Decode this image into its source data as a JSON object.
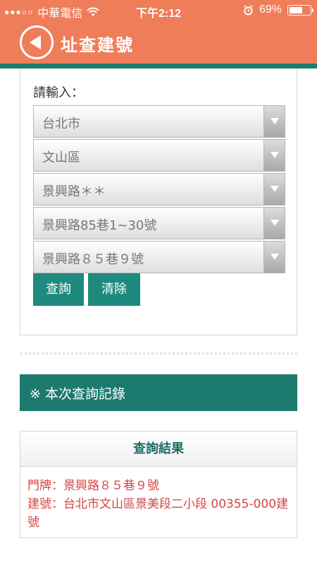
{
  "status_bar": {
    "carrier": "中華電信",
    "time": "下午2:12",
    "battery": "69%",
    "battery_level": 0.69
  },
  "header": {
    "title": "址查建號"
  },
  "form": {
    "prompt": "請輸入：",
    "selects": [
      {
        "value": "台北市"
      },
      {
        "value": "文山區"
      },
      {
        "value": "景興路＊＊"
      },
      {
        "value": "景興路85巷1~30號"
      },
      {
        "value": "景興路８５巷９號"
      }
    ],
    "query_label": "查詢",
    "clear_label": "清除"
  },
  "record": {
    "title": "※ 本次查詢記錄"
  },
  "results": {
    "header": "查詢結果",
    "lines": [
      "門牌：景興路８５巷９號",
      "建號：台北市文山區景美段二小段 00355-000建號"
    ]
  },
  "colors": {
    "header": "#ef7d5a",
    "accent": "#1c7a6e",
    "button": "#1e8a7e",
    "result_text": "#d64545"
  }
}
